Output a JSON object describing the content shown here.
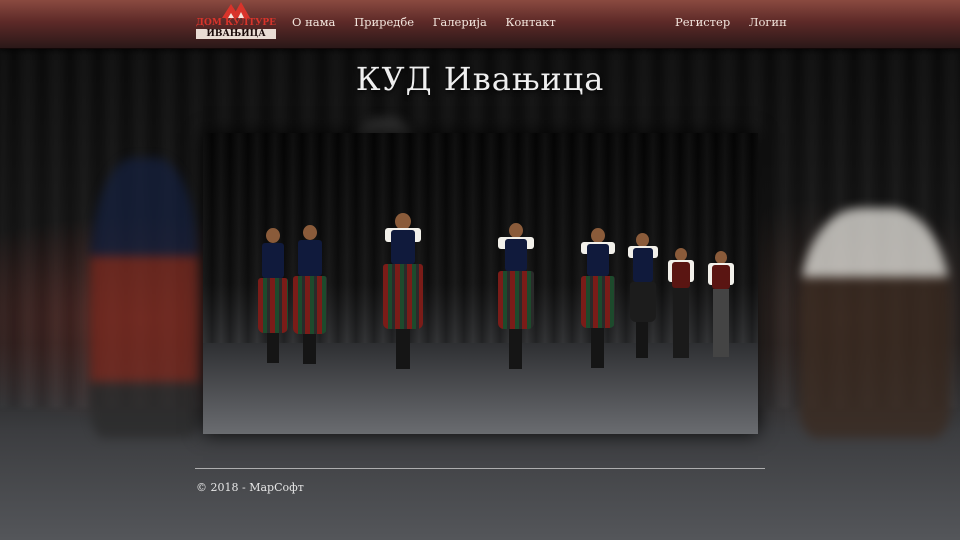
{
  "header": {
    "logo": {
      "line1": "ДОМ КУЛТУРЕ",
      "line2": "ИВАЊИЦА",
      "icon": "triangles-logo-icon",
      "color": "#d9342b"
    },
    "nav_left": [
      "О нама",
      "Приредбе",
      "Галерија",
      "Контакт"
    ],
    "nav_right": [
      "Регистер",
      "Логин"
    ]
  },
  "main": {
    "title": "КУД Ивањица"
  },
  "footer": {
    "copyright": "© 2018 - МарСофт"
  },
  "colors": {
    "header_top": "#8a4a40",
    "header_bottom": "#2a1818",
    "page_background": "#0b0b0b",
    "text": "#efefef"
  }
}
